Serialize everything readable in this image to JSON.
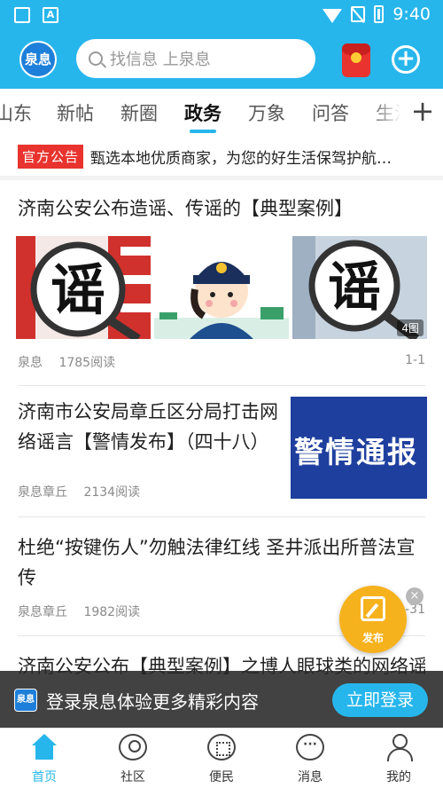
{
  "status_bar": {
    "time": "9:40",
    "icons": [
      "image-icon",
      "a-icon",
      "wifi-icon",
      "no-sim-icon",
      "battery-charging-icon"
    ],
    "a_glyph": "A"
  },
  "header": {
    "logo_text": "泉息",
    "search_placeholder": "找信息 上泉息",
    "icons": [
      "search-icon",
      "red-packet-icon",
      "add-icon"
    ],
    "add_glyph": "+",
    "accent_color": "#27b6ec"
  },
  "tabs": {
    "items": [
      "山东",
      "新帖",
      "新圈",
      "政务",
      "万象",
      "问答",
      "生活"
    ],
    "active": "政务",
    "more_glyph": "+"
  },
  "notice": {
    "tag": "官方公告",
    "text": "甄选本地优质商家，为您的好生活保驾护航…"
  },
  "articles": [
    {
      "title": "济南公安公布造谣、传谣的【典型案例】",
      "images": [
        "谣",
        "police-cartoon",
        "谣"
      ],
      "image_count": "4图",
      "source": "泉息",
      "reads": "1785阅读",
      "right_meta": "1-1"
    },
    {
      "title": "济南市公安局章丘区分局打击网络谣言【警情发布】（四十八）",
      "image_text": "警情通报",
      "source": "泉息章丘",
      "reads": "2134阅读"
    },
    {
      "title": "杜绝“按键伤人”勿触法律红线  圣井派出所普法宣传",
      "source": "泉息章丘",
      "reads": "1982阅读",
      "right_meta": "-31"
    },
    {
      "title": "济南公安公布【典型案例】之博人眼球类的网络谣言案件"
    }
  ],
  "fab": {
    "label": "发布",
    "close_glyph": "×"
  },
  "login_banner": {
    "logo_text": "泉息",
    "text": "登录泉息体验更多精彩内容",
    "button": "立即登录"
  },
  "bottom_nav": {
    "items": [
      {
        "label": "首页",
        "icon": "home-icon",
        "active": true
      },
      {
        "label": "社区",
        "icon": "community-icon",
        "active": false
      },
      {
        "label": "便民",
        "icon": "services-icon",
        "active": false
      },
      {
        "label": "消息",
        "icon": "message-icon",
        "active": false
      },
      {
        "label": "我的",
        "icon": "profile-icon",
        "active": false
      }
    ]
  }
}
